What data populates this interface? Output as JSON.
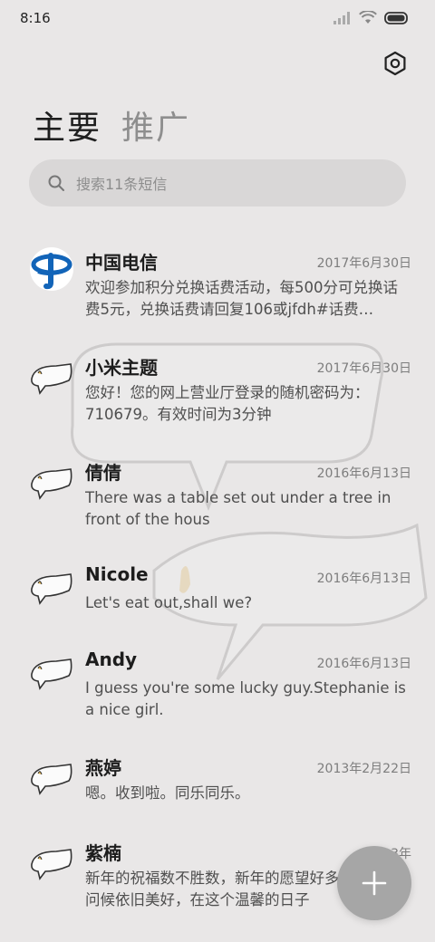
{
  "status": {
    "time": "8:16"
  },
  "tabs": [
    {
      "label": "主要",
      "active": true
    },
    {
      "label": "推广",
      "active": false
    }
  ],
  "search": {
    "placeholder": "搜索11条短信"
  },
  "conversations": [
    {
      "name": "中国电信",
      "date": "2017年6月30日",
      "preview": "欢迎参加积分兑换话费活动，每500分可兑换话费5元，兑换话费请回复106或jfdh#话费…",
      "avatar": "china-telecom-logo"
    },
    {
      "name": "小米主题",
      "date": "2017年6月30日",
      "preview": "您好！您的网上营业厅登录的随机密码为：710679。有效时间为3分钟",
      "avatar": "cartoon-avatar"
    },
    {
      "name": "倩倩",
      "date": "2016年6月13日",
      "preview": "There was a table set out under a tree in front of the hous",
      "avatar": "cartoon-avatar"
    },
    {
      "name": "Nicole",
      "date": "2016年6月13日",
      "preview": "Let's eat out,shall we?",
      "avatar": "cartoon-avatar"
    },
    {
      "name": "Andy",
      "date": "2016年6月13日",
      "preview": "I guess you're some lucky guy.Stephanie is a nice girl.",
      "avatar": "cartoon-avatar"
    },
    {
      "name": "燕婷",
      "date": "2013年2月22日",
      "preview": "嗯。收到啦。同乐同乐。",
      "avatar": "cartoon-avatar"
    },
    {
      "name": "紫楠",
      "date": "2013年",
      "preview": "新年的祝福数不胜数，新年的愿望好多，新年的问候依旧美好，在这个温馨的日子",
      "avatar": "cartoon-avatar"
    }
  ],
  "colors": {
    "accent_fab": "#a6a6a6",
    "telecom_blue": "#1264b8"
  }
}
